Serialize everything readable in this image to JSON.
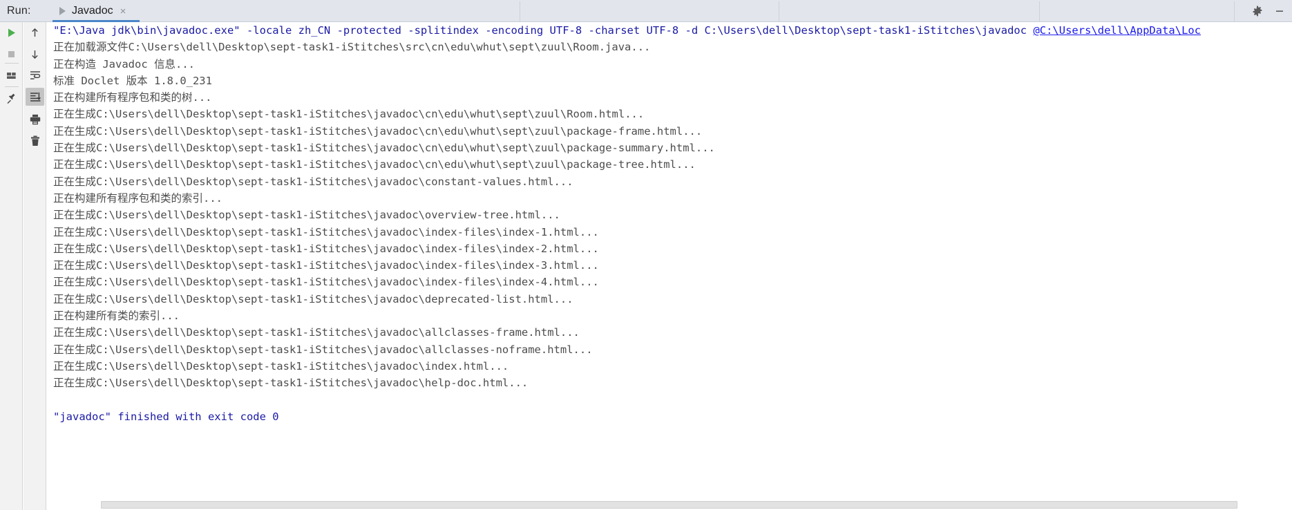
{
  "window": {
    "run_label": "Run:",
    "tab": {
      "title": "Javadoc",
      "close_glyph": "×",
      "run_icon": "play-triangle-icon"
    },
    "actions": {
      "settings_label": "gear-icon",
      "minimize_label": "minimize-icon"
    }
  },
  "left_toolbar": {
    "group1": [
      {
        "name": "rerun-button",
        "icon": "play-icon",
        "selected": false
      },
      {
        "name": "stop-button",
        "icon": "stop-square-icon",
        "selected": false
      },
      {
        "name": "layout-button",
        "icon": "layout-icon",
        "selected": false
      },
      {
        "name": "pin-tab-button",
        "icon": "pin-icon",
        "selected": false
      }
    ],
    "group2": [
      {
        "name": "up-button",
        "icon": "arrow-up-icon",
        "selected": false
      },
      {
        "name": "down-button",
        "icon": "arrow-down-icon",
        "selected": false
      },
      {
        "name": "soft-wrap-button",
        "icon": "soft-wrap-icon",
        "selected": false
      },
      {
        "name": "scroll-to-end-button",
        "icon": "scroll-to-end-icon",
        "selected": true
      },
      {
        "name": "print-button",
        "icon": "printer-icon",
        "selected": false
      },
      {
        "name": "clear-all-button",
        "icon": "trash-icon",
        "selected": false
      }
    ]
  },
  "console": {
    "lines": [
      {
        "type": "command",
        "parts": [
          {
            "style": "cmd",
            "text": "\"E:\\Java jdk\\bin\\javadoc.exe\" -locale zh_CN -protected -splitindex -encoding UTF-8 -charset UTF-8 -d C:\\Users\\dell\\Desktop\\sept-task1-iStitches\\javadoc "
          },
          {
            "style": "link",
            "text": "@C:\\Users\\dell\\AppData\\Loc"
          }
        ]
      },
      {
        "type": "output",
        "style": "sys",
        "text": "正在加载源文件C:\\Users\\dell\\Desktop\\sept-task1-iStitches\\src\\cn\\edu\\whut\\sept\\zuul\\Room.java..."
      },
      {
        "type": "output",
        "style": "sys",
        "text": "正在构造 Javadoc 信息..."
      },
      {
        "type": "output",
        "style": "sys",
        "text": "标准 Doclet 版本 1.8.0_231"
      },
      {
        "type": "output",
        "style": "sys",
        "text": "正在构建所有程序包和类的树..."
      },
      {
        "type": "output",
        "style": "gen",
        "text": "正在生成C:\\Users\\dell\\Desktop\\sept-task1-iStitches\\javadoc\\cn\\edu\\whut\\sept\\zuul\\Room.html..."
      },
      {
        "type": "output",
        "style": "gen",
        "text": "正在生成C:\\Users\\dell\\Desktop\\sept-task1-iStitches\\javadoc\\cn\\edu\\whut\\sept\\zuul\\package-frame.html..."
      },
      {
        "type": "output",
        "style": "gen",
        "text": "正在生成C:\\Users\\dell\\Desktop\\sept-task1-iStitches\\javadoc\\cn\\edu\\whut\\sept\\zuul\\package-summary.html..."
      },
      {
        "type": "output",
        "style": "gen",
        "text": "正在生成C:\\Users\\dell\\Desktop\\sept-task1-iStitches\\javadoc\\cn\\edu\\whut\\sept\\zuul\\package-tree.html..."
      },
      {
        "type": "output",
        "style": "gen",
        "text": "正在生成C:\\Users\\dell\\Desktop\\sept-task1-iStitches\\javadoc\\constant-values.html..."
      },
      {
        "type": "output",
        "style": "sys",
        "text": "正在构建所有程序包和类的索引..."
      },
      {
        "type": "output",
        "style": "gen",
        "text": "正在生成C:\\Users\\dell\\Desktop\\sept-task1-iStitches\\javadoc\\overview-tree.html..."
      },
      {
        "type": "output",
        "style": "gen",
        "text": "正在生成C:\\Users\\dell\\Desktop\\sept-task1-iStitches\\javadoc\\index-files\\index-1.html..."
      },
      {
        "type": "output",
        "style": "gen",
        "text": "正在生成C:\\Users\\dell\\Desktop\\sept-task1-iStitches\\javadoc\\index-files\\index-2.html..."
      },
      {
        "type": "output",
        "style": "gen",
        "text": "正在生成C:\\Users\\dell\\Desktop\\sept-task1-iStitches\\javadoc\\index-files\\index-3.html..."
      },
      {
        "type": "output",
        "style": "gen",
        "text": "正在生成C:\\Users\\dell\\Desktop\\sept-task1-iStitches\\javadoc\\index-files\\index-4.html..."
      },
      {
        "type": "output",
        "style": "gen",
        "text": "正在生成C:\\Users\\dell\\Desktop\\sept-task1-iStitches\\javadoc\\deprecated-list.html..."
      },
      {
        "type": "output",
        "style": "sys",
        "text": "正在构建所有类的索引..."
      },
      {
        "type": "output",
        "style": "gen",
        "text": "正在生成C:\\Users\\dell\\Desktop\\sept-task1-iStitches\\javadoc\\allclasses-frame.html..."
      },
      {
        "type": "output",
        "style": "gen",
        "text": "正在生成C:\\Users\\dell\\Desktop\\sept-task1-iStitches\\javadoc\\allclasses-noframe.html..."
      },
      {
        "type": "output",
        "style": "gen",
        "text": "正在生成C:\\Users\\dell\\Desktop\\sept-task1-iStitches\\javadoc\\index.html..."
      },
      {
        "type": "output",
        "style": "gen",
        "text": "正在生成C:\\Users\\dell\\Desktop\\sept-task1-iStitches\\javadoc\\help-doc.html..."
      },
      {
        "type": "blank",
        "text": ""
      },
      {
        "type": "output",
        "style": "exit",
        "text": "\"javadoc\" finished with exit code 0"
      }
    ]
  },
  "colors": {
    "topbar_bg": "#e2e5ec",
    "tab_underline": "#4a86c8",
    "gutter_bg": "#f2f2f2",
    "console_bg": "#ffffff",
    "command_text": "#1a1aa6",
    "link_text": "#1a1aec",
    "output_text": "#4d4d4d",
    "selected_tool_bg": "#c4c4c4",
    "run_green": "#4caf50"
  }
}
